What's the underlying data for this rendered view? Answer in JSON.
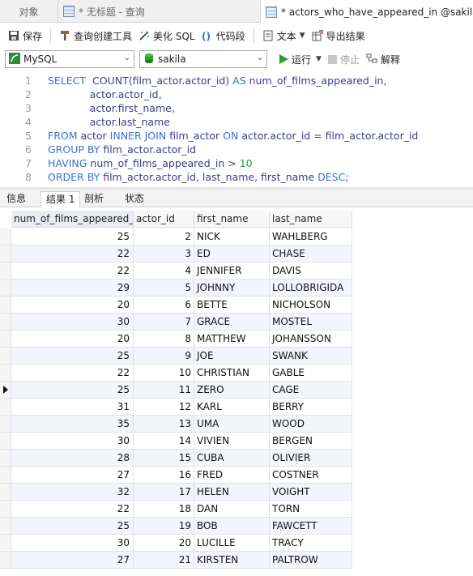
{
  "tabs": [
    {
      "label": "对象",
      "icon": ""
    },
    {
      "label": "* 无标题 - 查询",
      "icon": "query-icon"
    },
    {
      "label": "* actors_who_have_appeared_in @sakila (",
      "icon": "query-icon"
    }
  ],
  "toolbar": {
    "save": "保存",
    "query_builder": "查询创建工具",
    "beautify": "美化 SQL",
    "snippet": "代码段",
    "text": "文本",
    "export": "导出结果"
  },
  "connection": {
    "type": "MySQL",
    "database": "sakila"
  },
  "run": {
    "run_label": "运行",
    "stop_label": "停止",
    "explain_label": "解释"
  },
  "sql": {
    "line_numbers": [
      "1",
      "2",
      "3",
      "4",
      "5",
      "6",
      "7",
      "8"
    ],
    "lines": [
      [
        {
          "t": "SELECT",
          "k": "kw"
        },
        {
          "t": "  COUNT(film_actor.actor_id) ",
          "k": "id"
        },
        {
          "t": "AS",
          "k": "kw"
        },
        {
          "t": " num_of_films_appeared_in,",
          "k": "id"
        }
      ],
      [
        {
          "t": "             actor.actor_id,",
          "k": "id"
        }
      ],
      [
        {
          "t": "             actor.first_name,",
          "k": "id"
        }
      ],
      [
        {
          "t": "             actor.last_name",
          "k": "id"
        }
      ],
      [
        {
          "t": "FROM",
          "k": "kw"
        },
        {
          "t": " actor ",
          "k": "id"
        },
        {
          "t": "INNER JOIN",
          "k": "kw"
        },
        {
          "t": " film_actor ",
          "k": "id"
        },
        {
          "t": "ON",
          "k": "kw"
        },
        {
          "t": " actor.actor_id = film_actor.actor_id",
          "k": "id"
        }
      ],
      [
        {
          "t": "GROUP BY",
          "k": "kw"
        },
        {
          "t": " film_actor.actor_id",
          "k": "id"
        }
      ],
      [
        {
          "t": "HAVING",
          "k": "kw"
        },
        {
          "t": " num_of_films_appeared_in > ",
          "k": "id"
        },
        {
          "t": "10",
          "k": "num"
        }
      ],
      [
        {
          "t": "ORDER BY",
          "k": "kw"
        },
        {
          "t": " film_actor.actor_id, last_name, first_name ",
          "k": "id"
        },
        {
          "t": "DESC",
          "k": "kw"
        },
        {
          "t": ";",
          "k": "id"
        }
      ]
    ]
  },
  "result_tabs": [
    "信息",
    "结果 1",
    "剖析",
    "状态"
  ],
  "result_active_tab": 1,
  "grid": {
    "columns": [
      "num_of_films_appeared_in",
      "actor_id",
      "first_name",
      "last_name"
    ],
    "current_row": 9,
    "rows": [
      [
        "25",
        "2",
        "NICK",
        "WAHLBERG"
      ],
      [
        "22",
        "3",
        "ED",
        "CHASE"
      ],
      [
        "22",
        "4",
        "JENNIFER",
        "DAVIS"
      ],
      [
        "29",
        "5",
        "JOHNNY",
        "LOLLOBRIGIDA"
      ],
      [
        "20",
        "6",
        "BETTE",
        "NICHOLSON"
      ],
      [
        "30",
        "7",
        "GRACE",
        "MOSTEL"
      ],
      [
        "20",
        "8",
        "MATTHEW",
        "JOHANSSON"
      ],
      [
        "25",
        "9",
        "JOE",
        "SWANK"
      ],
      [
        "22",
        "10",
        "CHRISTIAN",
        "GABLE"
      ],
      [
        "25",
        "11",
        "ZERO",
        "CAGE"
      ],
      [
        "31",
        "12",
        "KARL",
        "BERRY"
      ],
      [
        "35",
        "13",
        "UMA",
        "WOOD"
      ],
      [
        "30",
        "14",
        "VIVIEN",
        "BERGEN"
      ],
      [
        "28",
        "15",
        "CUBA",
        "OLIVIER"
      ],
      [
        "27",
        "16",
        "FRED",
        "COSTNER"
      ],
      [
        "32",
        "17",
        "HELEN",
        "VOIGHT"
      ],
      [
        "22",
        "18",
        "DAN",
        "TORN"
      ],
      [
        "25",
        "19",
        "BOB",
        "FAWCETT"
      ],
      [
        "30",
        "20",
        "LUCILLE",
        "TRACY"
      ],
      [
        "27",
        "21",
        "KIRSTEN",
        "PALTROW"
      ]
    ]
  },
  "colors": {
    "keyword": "#3b6fd4",
    "number": "#2e9b3a",
    "identifier": "#3b3b8f",
    "run_green": "#2aa02a",
    "alt_row": "#f2f5fb"
  }
}
